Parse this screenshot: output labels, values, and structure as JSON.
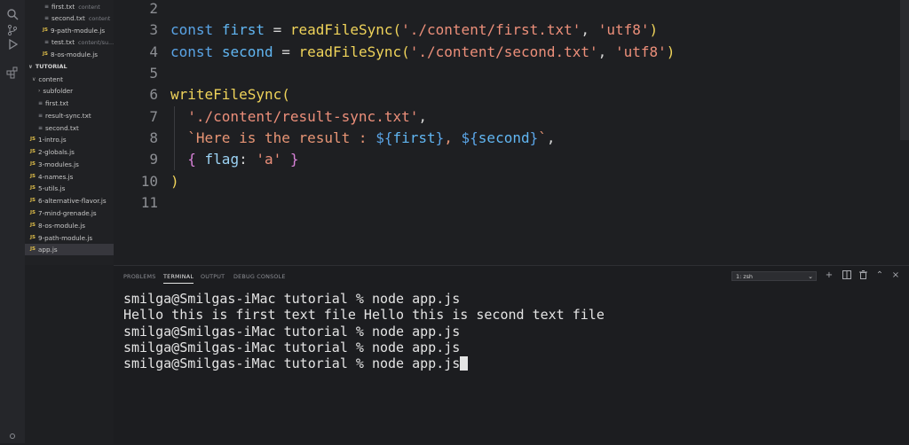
{
  "explorer": {
    "top_files": [
      {
        "name": "first.txt",
        "suffix": "content",
        "type": "txt"
      },
      {
        "name": "second.txt",
        "suffix": "content",
        "type": "txt"
      },
      {
        "name": "9-path-module.js",
        "suffix": "",
        "type": "js"
      },
      {
        "name": "test.txt",
        "suffix": "content/su...",
        "type": "txt"
      },
      {
        "name": "8-os-module.js",
        "suffix": "",
        "type": "js"
      }
    ],
    "section_title": "TUTORIAL",
    "tree": [
      {
        "name": "content",
        "type": "folder-open",
        "indent": 1
      },
      {
        "name": "subfolder",
        "type": "folder",
        "indent": 2
      },
      {
        "name": "first.txt",
        "type": "txt",
        "indent": 2
      },
      {
        "name": "result-sync.txt",
        "type": "txt",
        "indent": 2
      },
      {
        "name": "second.txt",
        "type": "txt",
        "indent": 2
      },
      {
        "name": "1-intro.js",
        "type": "js",
        "indent": 1
      },
      {
        "name": "2-globals.js",
        "type": "js",
        "indent": 1
      },
      {
        "name": "3-modules.js",
        "type": "js",
        "indent": 1
      },
      {
        "name": "4-names.js",
        "type": "js",
        "indent": 1
      },
      {
        "name": "5-utils.js",
        "type": "js",
        "indent": 1
      },
      {
        "name": "6-alternative-flavor.js",
        "type": "js",
        "indent": 1
      },
      {
        "name": "7-mind-grenade.js",
        "type": "js",
        "indent": 1
      },
      {
        "name": "8-os-module.js",
        "type": "js",
        "indent": 1
      },
      {
        "name": "9-path-module.js",
        "type": "js",
        "indent": 1
      },
      {
        "name": "app.js",
        "type": "js",
        "indent": 1,
        "selected": true
      }
    ]
  },
  "editor": {
    "line_numbers": [
      "2",
      "3",
      "4",
      "5",
      "6",
      "7",
      "8",
      "9",
      "10",
      "11"
    ],
    "line3": {
      "kw": "const",
      "var": "first",
      "eq": " = ",
      "fn": "readFileSync",
      "open": "(",
      "arg1": "'./content/first.txt'",
      "comma": ", ",
      "arg2": "'utf8'",
      "close": ")"
    },
    "line4": {
      "kw": "const",
      "var": "second",
      "eq": " = ",
      "fn": "readFileSync",
      "open": "(",
      "arg1": "'./content/second.txt'",
      "comma": ", ",
      "arg2": "'utf8'",
      "close": ")"
    },
    "line6": {
      "fn": "writeFileSync",
      "open": "("
    },
    "line7": {
      "str": "'./content/result-sync.txt'",
      "comma": ","
    },
    "line8": {
      "tpl_start": "`Here is the result : ",
      "i1_open": "${",
      "i1_var": "first",
      "i1_close": "}",
      "mid": ", ",
      "i2_open": "${",
      "i2_var": "second",
      "i2_close": "}",
      "tpl_end": "`",
      "comma": ","
    },
    "line9": {
      "open": "{",
      "prop": " flag",
      "colon": ": ",
      "val": "'a'",
      "close": " }"
    },
    "line10": {
      "close": ")"
    }
  },
  "panel": {
    "tabs": [
      "PROBLEMS",
      "TERMINAL",
      "OUTPUT",
      "DEBUG CONSOLE"
    ],
    "active_tab": "TERMINAL",
    "terminal_select": "1: zsh",
    "terminal_lines": [
      "smilga@Smilgas-iMac tutorial % node app.js",
      "Hello this is first text file Hello this is second text file",
      "smilga@Smilgas-iMac tutorial % node app.js",
      "smilga@Smilgas-iMac tutorial % node app.js",
      "smilga@Smilgas-iMac tutorial % node app.js"
    ]
  },
  "colors": {
    "background": "#1e1f22",
    "keyword": "#5aa4e6",
    "function": "#efd35a",
    "string": "#ec8f7a"
  }
}
